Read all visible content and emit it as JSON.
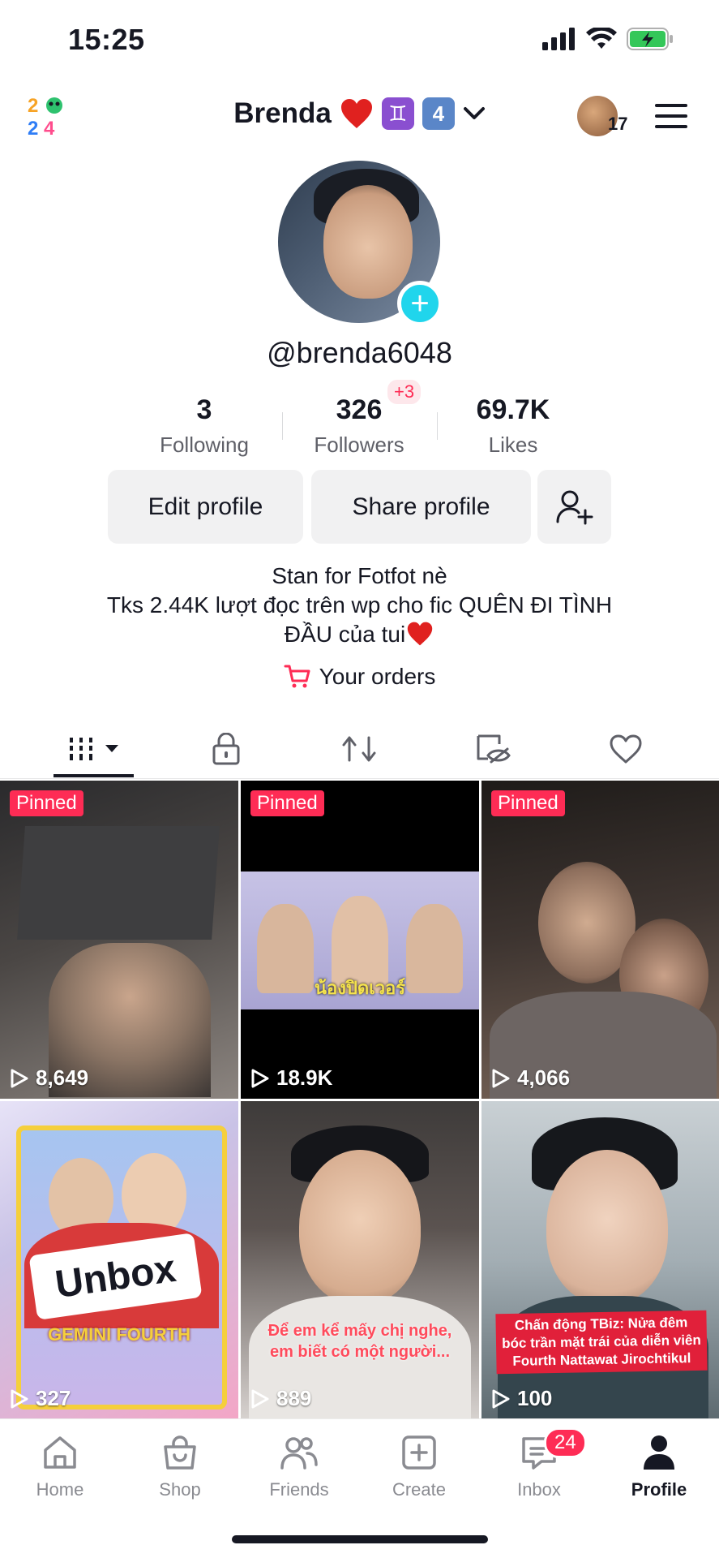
{
  "status_bar": {
    "time": "15:25",
    "icons": [
      "signal-icon",
      "wifi-icon",
      "battery-charging-icon"
    ]
  },
  "header": {
    "logo": "2024-logo",
    "profile_name": "Brenda",
    "name_emoji_1": "♊",
    "name_emoji_2": "4",
    "right_badge_count": "17"
  },
  "profile": {
    "username": "@brenda6048",
    "stats": {
      "following_count": "3",
      "following_label": "Following",
      "followers_count": "326",
      "followers_label": "Followers",
      "followers_new": "+3",
      "likes_count": "69.7K",
      "likes_label": "Likes"
    },
    "buttons": {
      "edit": "Edit profile",
      "share": "Share profile"
    },
    "bio": {
      "line1": "Stan for Fotfot nè",
      "line2": "Tks 2.44K lượt đọc trên wp cho fic QUÊN ĐI TÌNH",
      "line3": "ĐẦU của tui"
    },
    "orders_label": "Your orders"
  },
  "videos": [
    {
      "pinned": "Pinned",
      "views": "8,649",
      "overlay_text": "",
      "colors": [
        "#3a3a3c",
        "#7a7370"
      ]
    },
    {
      "pinned": "Pinned",
      "views": "18.9K",
      "overlay_text": "น้องปิดเวอร์",
      "colors": [
        "#000000",
        "#b9b6d9"
      ]
    },
    {
      "pinned": "Pinned",
      "views": "4,066",
      "overlay_text": "",
      "colors": [
        "#2b2724",
        "#6b5a50"
      ]
    },
    {
      "pinned": "",
      "views": "327",
      "overlay_text": "Unbox",
      "sub_text": "GEMINI FOURTH",
      "colors": [
        "#c9c2e6",
        "#d83a3a"
      ]
    },
    {
      "pinned": "",
      "views": "889",
      "overlay_text": "Để em kể mấy chị nghe, em biết có một người...",
      "colors": [
        "#3e3b3a",
        "#d6b8a0"
      ]
    },
    {
      "pinned": "",
      "views": "100",
      "overlay_text": "Chấn động TBiz: Nửa đêm bóc trần mặt trái của diễn viên Fourth Nattawat Jirochtikul",
      "colors": [
        "#5d6a70",
        "#c9d0d4"
      ]
    }
  ],
  "bottom_nav": {
    "home": "Home",
    "shop": "Shop",
    "friends": "Friends",
    "create": "Create",
    "inbox": "Inbox",
    "inbox_badge": "24",
    "profile": "Profile"
  },
  "colors": {
    "accent": "#fe2c55",
    "teal": "#20d5ec",
    "text": "#161823",
    "muted": "#5f6068",
    "button_bg": "#f1f1f2"
  }
}
